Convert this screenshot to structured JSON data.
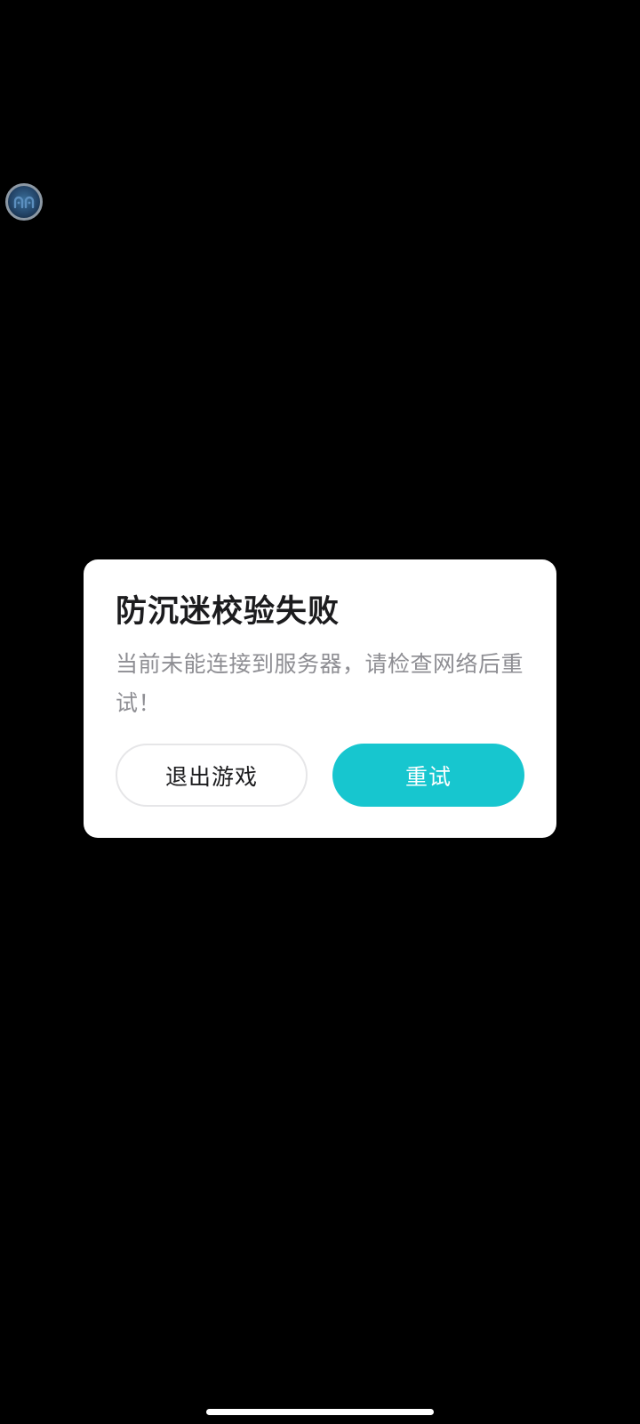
{
  "floating_ball": {
    "icon": "game-assistant-icon"
  },
  "dialog": {
    "title": "防沉迷校验失败",
    "message": "当前未能连接到服务器，请检查网络后重试！",
    "buttons": {
      "exit_label": "退出游戏",
      "retry_label": "重试"
    }
  },
  "colors": {
    "background": "#000000",
    "dialog_background": "#ffffff",
    "title": "#1c1c1e",
    "message": "#8e8e93",
    "retry_button": "#17c6cf",
    "exit_button_border": "#e6e6e8"
  }
}
